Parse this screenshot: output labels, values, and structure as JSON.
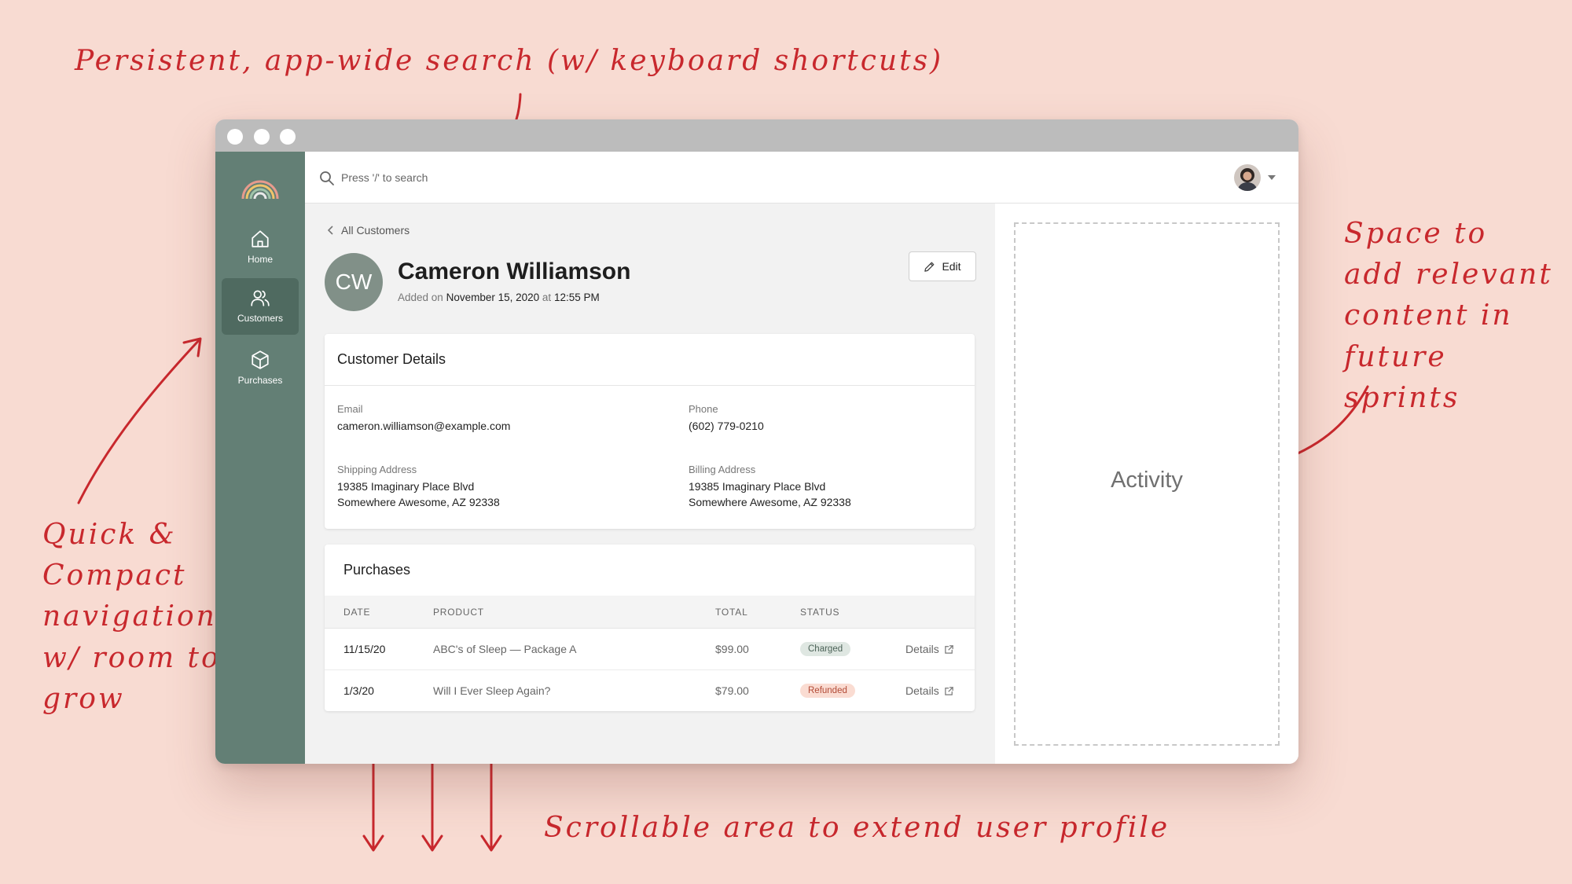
{
  "annotations": {
    "search": "Persistent, app-wide search (w/ keyboard shortcuts)",
    "space": "Space to\nadd relevant\ncontent in\nfuture sprints",
    "nav": "Quick &\nCompact\nnavigation\nw/ room to\ngrow",
    "scroll": "Scrollable area to extend user profile"
  },
  "colors": {
    "background": "#f8dbd2",
    "annotation": "#c8282d",
    "sidebar": "#637f75",
    "sidebar_active": "#4f6a60"
  },
  "sidebar": {
    "logo_icon": "rainbow-logo",
    "items": [
      {
        "label": "Home",
        "icon": "home-icon",
        "active": false
      },
      {
        "label": "Customers",
        "icon": "users-icon",
        "active": true
      },
      {
        "label": "Purchases",
        "icon": "box-icon",
        "active": false
      }
    ]
  },
  "topbar": {
    "search_placeholder": "Press '/' to search"
  },
  "customer": {
    "back_label": "All Customers",
    "initials": "CW",
    "name": "Cameron Williamson",
    "added_prefix": "Added on",
    "added_date": "November 15, 2020",
    "added_at": "at",
    "added_time": "12:55 PM",
    "edit_label": "Edit"
  },
  "details": {
    "title": "Customer Details",
    "email_label": "Email",
    "email": "cameron.williamson@example.com",
    "phone_label": "Phone",
    "phone": "(602) 779-0210",
    "shipping_label": "Shipping Address",
    "shipping_line1": "19385 Imaginary Place Blvd",
    "shipping_line2": "Somewhere Awesome, AZ 92338",
    "billing_label": "Billing Address",
    "billing_line1": "19385 Imaginary Place Blvd",
    "billing_line2": "Somewhere Awesome, AZ 92338"
  },
  "purchases": {
    "title": "Purchases",
    "columns": [
      "DATE",
      "PRODUCT",
      "TOTAL",
      "STATUS"
    ],
    "rows": [
      {
        "date": "11/15/20",
        "product": "ABC's of Sleep — Package A",
        "total": "$99.00",
        "status": "Charged",
        "details": "Details"
      },
      {
        "date": "1/3/20",
        "product": "Will I Ever Sleep Again?",
        "total": "$79.00",
        "status": "Refunded",
        "details": "Details"
      }
    ]
  },
  "activity": {
    "label": "Activity"
  }
}
